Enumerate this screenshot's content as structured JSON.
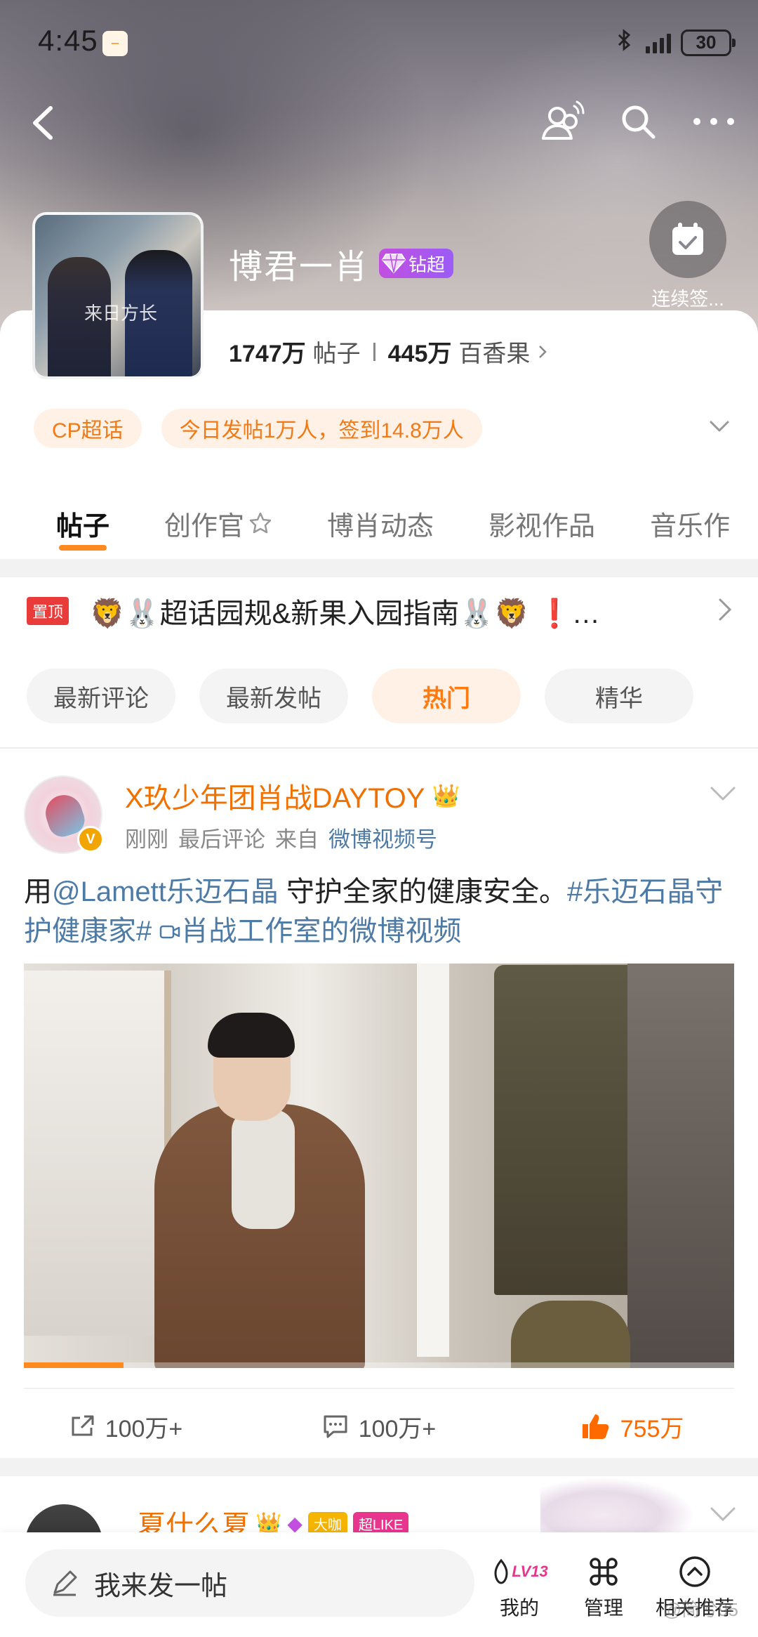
{
  "status_bar": {
    "time": "4:45",
    "battery": "30",
    "app_badge_icon": "app-notification-icon"
  },
  "nav": {
    "back_icon": "back-arrow-icon",
    "icons": [
      "people-chat-icon",
      "search-icon",
      "more-icon"
    ]
  },
  "topic": {
    "name": "博君一肖",
    "badge": "钻超",
    "posts_count": "1747万",
    "posts_label": "帖子",
    "fans_count": "445万",
    "fans_label": "百香果",
    "checkin_label": "连续签..."
  },
  "chips": [
    {
      "label": "CP超话"
    },
    {
      "label": "今日发帖1万人，签到14.8万人"
    }
  ],
  "tabs": [
    {
      "label": "帖子",
      "active": true
    },
    {
      "label": "创作官",
      "active": false
    },
    {
      "label": "博肖动态",
      "active": false
    },
    {
      "label": "影视作品",
      "active": false
    },
    {
      "label": "音乐作",
      "active": false
    }
  ],
  "pinned": {
    "tag": "置顶",
    "text": "🦁🐰超话园规&新果入园指南🐰🦁 ❗…"
  },
  "filters": [
    {
      "label": "最新评论",
      "active": false
    },
    {
      "label": "最新发帖",
      "active": false
    },
    {
      "label": "热门",
      "active": true
    },
    {
      "label": "精华",
      "active": false
    }
  ],
  "post": {
    "username": "X玖少年团肖战DAYTOY",
    "verified_badge": "V",
    "time": "刚刚",
    "last_comment": "最后评论",
    "from_label": "来自",
    "source": "微博视频号",
    "body_prefix": "用",
    "mention": "@Lamett乐迈石晶",
    "body_mid": " 守护全家的健康安全。",
    "hashtag": "#乐迈石晶守护健康家#",
    "video_link": "肖战工作室的微博视频",
    "video_progress": 0.14,
    "shares": "100万+",
    "comments": "100万+",
    "likes": "755万"
  },
  "post2": {
    "username": "夏什么夏",
    "badge_dakka": "大咖",
    "badge_superlike": "超LIKE"
  },
  "bottom": {
    "compose_placeholder": "我来发一帖",
    "level": "LV13",
    "mine": "我的",
    "manage": "管理",
    "related": "相关推荐"
  },
  "watermark": "@简兮95",
  "colors": {
    "accent": "#ff7b12",
    "link": "#4e7ba6",
    "username": "#f07000",
    "pinned_tag": "#ea3b3b"
  }
}
